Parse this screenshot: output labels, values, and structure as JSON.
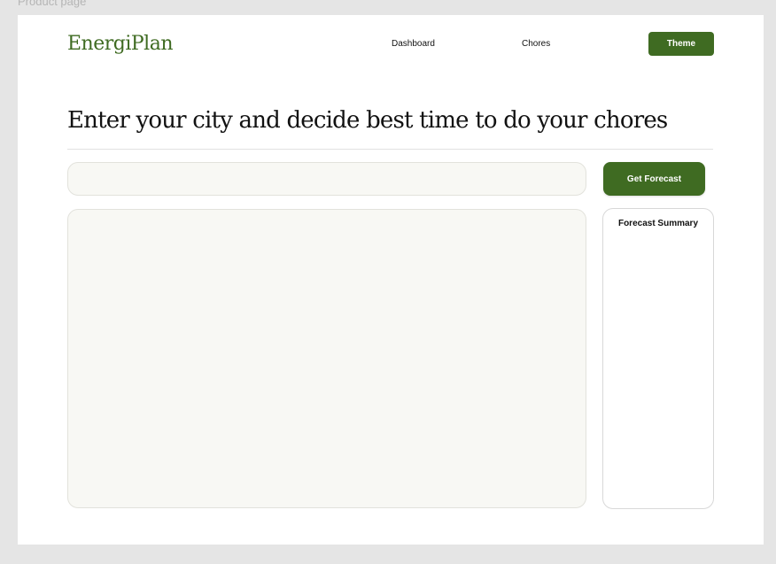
{
  "frame_label": "Product page",
  "brand": {
    "logo": "EnergiPlan",
    "accent_color": "#3f6b22"
  },
  "nav": {
    "dashboard": "Dashboard",
    "chores": "Chores",
    "theme_button": "Theme"
  },
  "main": {
    "heading": "Enter your city and decide best time to do your chores",
    "city_input": {
      "value": "",
      "placeholder": ""
    },
    "forecast_button": "Get Forecast"
  },
  "summary": {
    "title": "Forecast Summary"
  }
}
